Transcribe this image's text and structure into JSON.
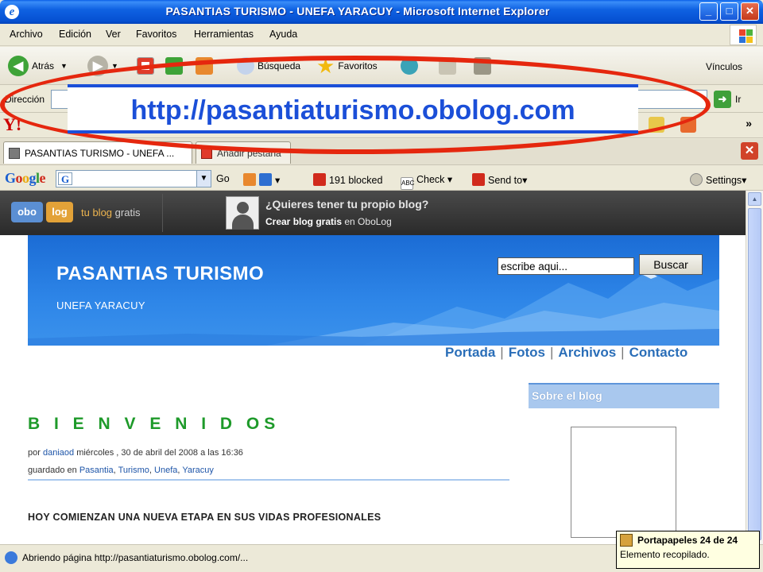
{
  "window": {
    "title": "PASANTIAS TURISMO - UNEFA YARACUY - Microsoft Internet Explorer"
  },
  "menu": [
    "Archivo",
    "Edición",
    "Ver",
    "Favoritos",
    "Herramientas",
    "Ayuda"
  ],
  "toolbar": {
    "back": "Atrás",
    "search": "Búsqueda",
    "favorites": "Favoritos",
    "links": "Vínculos"
  },
  "address": {
    "label": "Dirección",
    "go": "Ir"
  },
  "tabs": [
    {
      "label": "PASANTIAS TURISMO - UNEFA ..."
    },
    {
      "label": "Añadir pestaña"
    }
  ],
  "google": {
    "logo": "Google",
    "go": "Go",
    "blocked": "191 blocked",
    "check": "Check",
    "send": "Send to",
    "settings": "Settings"
  },
  "oblog": {
    "logo_a": "obo",
    "logo_b": "log",
    "tag_a": "tu blog",
    "tag_b": "gratis",
    "question": "¿Quieres tener tu propio blog?",
    "create_bold": "Crear blog gratis",
    "create_rest": "en OboLog"
  },
  "blog": {
    "title": "PASANTIAS TURISMO",
    "subtitle": "UNEFA YARACUY",
    "search_placeholder": "escribe aqui...",
    "search_button": "Buscar",
    "nav": [
      "Portada",
      "Fotos",
      "Archivos",
      "Contacto"
    ],
    "sidebar_title": "Sobre el blog",
    "post": {
      "title": "B I E N V E N I D OS",
      "meta_prefix": "por",
      "author": "daniaod",
      "date": "miércoles , 30 de abril del 2008 a las 16:36",
      "tags_prefix": "guardado en",
      "tags": [
        "Pasantia",
        "Turismo",
        "Unefa",
        "Yaracuy"
      ],
      "body": "HOY COMIENZAN UNA NUEVA ETAPA EN SUS VIDAS PROFESIONALES"
    }
  },
  "status": {
    "text": "Abriendo página http://pasantiaturismo.obolog.com/..."
  },
  "clipboard": {
    "title": "Portapapeles 24 de 24",
    "detail": "Elemento recopilado."
  },
  "overlay": {
    "url": "http://pasantiaturismo.obolog.com"
  },
  "colors": {
    "title_bar": "#0550D2",
    "accent_blue": "#2A6EB8",
    "header_blue": "#2E86E8",
    "post_green": "#1E9A2A",
    "ellipse_red": "#E5270E"
  }
}
